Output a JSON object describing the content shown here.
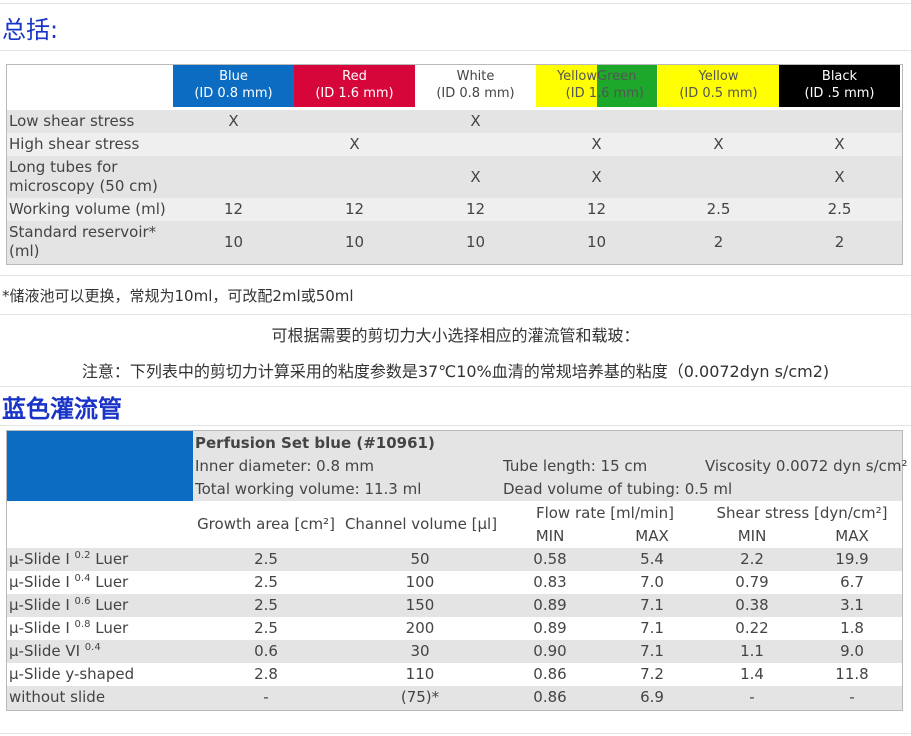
{
  "summary": {
    "heading": "总括:",
    "columns": [
      {
        "name": "Blue",
        "id": "(ID 0.8 mm)",
        "bg": "#0b6cc2",
        "fg": "#ffffff"
      },
      {
        "name": "Red",
        "id": "(ID 1.6 mm)",
        "bg": "#d7063a",
        "fg": "#ffffff"
      },
      {
        "name": "White",
        "id": "(ID 0.8 mm)",
        "bg": "#ffffff",
        "fg": "#444444"
      },
      {
        "name_left": "Yellow",
        "name_right": "Green",
        "id_left": "(ID 1",
        "id_right": ".6 mm)",
        "bg_left": "#ffff00",
        "bg_right": "#1ea82b",
        "fg": "#555555"
      },
      {
        "name": "Yellow",
        "id": "(ID 0.5 mm)",
        "bg": "#ffff00",
        "fg": "#555555"
      },
      {
        "name": "Black",
        "id": "(ID .5 mm)",
        "bg": "#000000",
        "fg": "#ffffff"
      }
    ],
    "rows": [
      {
        "label": "Low shear stress",
        "cells": [
          "X",
          "",
          "X",
          "",
          "",
          ""
        ]
      },
      {
        "label": "High shear stress",
        "cells": [
          "",
          "X",
          "",
          "X",
          "X",
          "X"
        ]
      },
      {
        "label": "Long tubes for microscopy (50 cm)",
        "label_lines": [
          "Long tubes for",
          "microscopy (50 cm)"
        ],
        "cells": [
          "",
          "",
          "X",
          "X",
          "",
          "X"
        ]
      },
      {
        "label": "Working volume (ml)",
        "cells": [
          "12",
          "12",
          "12",
          "12",
          "2.5",
          "2.5"
        ]
      },
      {
        "label": "Standard reservoir* (ml)",
        "label_lines": [
          "Standard reservoir*",
          "(ml)"
        ],
        "cells": [
          "10",
          "10",
          "10",
          "10",
          "2",
          "2"
        ]
      }
    ],
    "footnote": "*储液池可以更换，常规为10ml，可改配2ml或50ml"
  },
  "notes": {
    "line1": "可根据需要的剪切力大小选择相应的灌流管和载玻：",
    "line2": "注意：下列表中的剪切力计算采用的粘度参数是37℃10%血清的常规培养基的粘度（0.0072dyn s/cm2)"
  },
  "blue_set": {
    "heading": "蓝色灌流管",
    "title": "Perfusion Set blue (#10961)",
    "inner_diameter": "Inner diameter: 0.8 mm",
    "tube_length": "Tube length: 15 cm",
    "viscosity": "Viscosity 0.0072 dyn s/cm²",
    "total_volume": "Total working volume: 11.3 ml",
    "dead_volume": "Dead volume of tubing: 0.5 ml",
    "headers": {
      "growth_area": "Growth area [cm²]",
      "channel_volume": "Channel volume [µl]",
      "flow_rate": "Flow rate [ml/min]",
      "shear_stress": "Shear stress [dyn/cm²]",
      "min": "MIN",
      "max": "MAX"
    },
    "rows": [
      {
        "label": "µ-Slide I",
        "sup": "0.2",
        "suffix": " Luer",
        "growth": "2.5",
        "channel": "50",
        "flow_min": "0.58",
        "flow_max": "5.4",
        "shear_min": "2.2",
        "shear_max": "19.9"
      },
      {
        "label": "µ-Slide I",
        "sup": "0.4",
        "suffix": " Luer",
        "growth": "2.5",
        "channel": "100",
        "flow_min": "0.83",
        "flow_max": "7.0",
        "shear_min": "0.79",
        "shear_max": "6.7"
      },
      {
        "label": "µ-Slide I",
        "sup": "0.6",
        "suffix": " Luer",
        "growth": "2.5",
        "channel": "150",
        "flow_min": "0.89",
        "flow_max": "7.1",
        "shear_min": "0.38",
        "shear_max": "3.1"
      },
      {
        "label": "µ-Slide I",
        "sup": "0.8",
        "suffix": " Luer",
        "growth": "2.5",
        "channel": "200",
        "flow_min": "0.89",
        "flow_max": "7.1",
        "shear_min": "0.22",
        "shear_max": "1.8"
      },
      {
        "label": "µ-Slide VI",
        "sup": "0.4",
        "suffix": "",
        "growth": "0.6",
        "channel": "30",
        "flow_min": "0.90",
        "flow_max": "7.1",
        "shear_min": "1.1",
        "shear_max": "9.0"
      },
      {
        "label": "µ-Slide y-shaped",
        "sup": "",
        "suffix": "",
        "growth": "2.8",
        "channel": "110",
        "flow_min": "0.86",
        "flow_max": "7.2",
        "shear_min": "1.4",
        "shear_max": "11.8"
      },
      {
        "label": "without slide",
        "sup": "",
        "suffix": "",
        "growth": "-",
        "channel": "(75)*",
        "flow_min": "0.86",
        "flow_max": "6.9",
        "shear_min": "-",
        "shear_max": "-"
      }
    ]
  }
}
